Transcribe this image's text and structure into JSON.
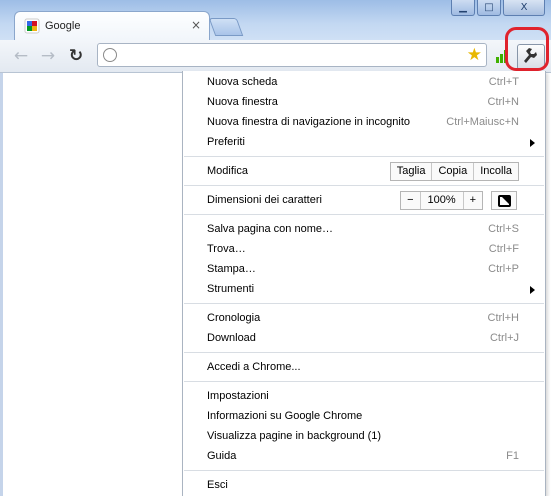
{
  "window": {
    "minimize_glyph": "▁",
    "maximize_glyph": "□",
    "close_glyph": "X"
  },
  "tab": {
    "title": "Google",
    "close_glyph": "×"
  },
  "toolbar": {
    "back_glyph": "←",
    "forward_glyph": "→",
    "reload_glyph": "↻",
    "address_value": "",
    "star_glyph": "★",
    "wrench_icon": "wrench-icon",
    "highlight_color": "#e0232d"
  },
  "menu": {
    "new_tab": {
      "label": "Nuova scheda",
      "shortcut": "Ctrl+T"
    },
    "new_window": {
      "label": "Nuova finestra",
      "shortcut": "Ctrl+N"
    },
    "incognito": {
      "label": "Nuova finestra di navigazione in incognito",
      "shortcut": "Ctrl+Maiusc+N"
    },
    "bookmarks": {
      "label": "Preferiti"
    },
    "edit": {
      "label": "Modifica",
      "cut": "Taglia",
      "copy": "Copia",
      "paste": "Incolla"
    },
    "zoom": {
      "label": "Dimensioni dei caratteri",
      "minus": "−",
      "value": "100%",
      "plus": "+"
    },
    "save_page": {
      "label": "Salva pagina con nome…",
      "shortcut": "Ctrl+S"
    },
    "find": {
      "label": "Trova…",
      "shortcut": "Ctrl+F"
    },
    "print": {
      "label": "Stampa…",
      "shortcut": "Ctrl+P"
    },
    "tools": {
      "label": "Strumenti"
    },
    "history": {
      "label": "Cronologia",
      "shortcut": "Ctrl+H"
    },
    "downloads": {
      "label": "Download",
      "shortcut": "Ctrl+J"
    },
    "signin": {
      "label": "Accedi a Chrome..."
    },
    "settings": {
      "label": "Impostazioni"
    },
    "about": {
      "label": "Informazioni su Google Chrome"
    },
    "background_pages": {
      "label": "Visualizza pagine in background (1)"
    },
    "help": {
      "label": "Guida",
      "shortcut": "F1"
    },
    "exit": {
      "label": "Esci"
    }
  }
}
